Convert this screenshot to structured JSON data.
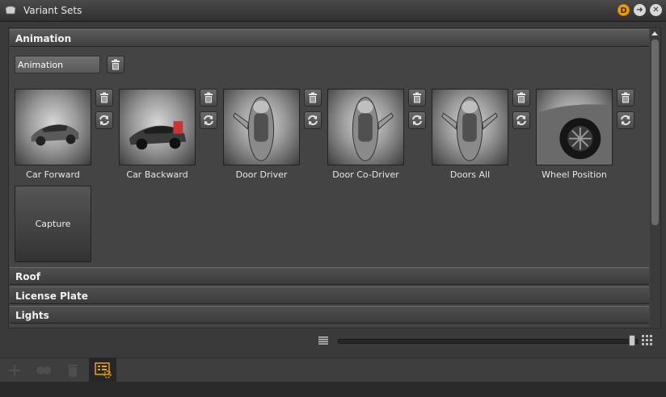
{
  "window": {
    "title": "Variant Sets",
    "badge": "D"
  },
  "sections": [
    {
      "label": "Animation",
      "expanded": true
    },
    {
      "label": "Roof",
      "expanded": false
    },
    {
      "label": "License Plate",
      "expanded": false
    },
    {
      "label": "Lights",
      "expanded": false
    }
  ],
  "animation": {
    "set_name": "Animation",
    "variants": [
      {
        "label": "Car Forward",
        "image": "car-front-three-quarter"
      },
      {
        "label": "Car Backward",
        "image": "car-rear-three-quarter"
      },
      {
        "label": "Door Driver",
        "image": "car-top-driver-door-open"
      },
      {
        "label": "Door Co-Driver",
        "image": "car-top-codriver-door-open"
      },
      {
        "label": "Doors All",
        "image": "car-top-all-doors-open"
      },
      {
        "label": "Wheel Position",
        "image": "car-wheel-closeup"
      }
    ],
    "capture_label": "Capture"
  },
  "footer": {
    "thumbnail_size_percent": 100
  },
  "icons": {
    "delete": "trash-icon",
    "refresh": "refresh-icon",
    "list_view": "list-view-icon",
    "grid_view": "grid-view-icon",
    "add": "plus-icon",
    "link": "link-icon",
    "bottom_delete": "trash-icon",
    "variant_sets_tool": "variant-sets-icon"
  },
  "colors": {
    "accent": "#f0a000",
    "panel": "#444444",
    "header": "#4f4f4f"
  }
}
